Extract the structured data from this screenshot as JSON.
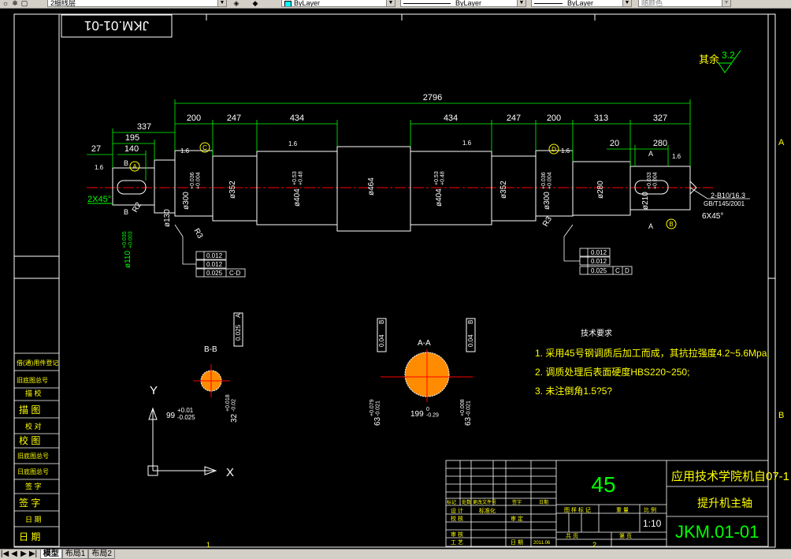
{
  "toolbar": {
    "layer_name": "2细线层",
    "color_value": "ByLayer",
    "linetype_value": "ByLayer",
    "lineweight_value": "ByLayer",
    "plotstyle_value": "随颜色"
  },
  "drawing": {
    "drawing_number_top": "JKM.01-01",
    "roughness_label": "其余",
    "roughness_value": "3.2",
    "overall_length": "2796",
    "dims_left": [
      "200",
      "247",
      "434"
    ],
    "dims_mid": [
      "434",
      "247"
    ],
    "dims_right": [
      "200",
      "313",
      "327"
    ],
    "dim_337": "337",
    "dim_195": "195",
    "dim_140": "140",
    "dim_27": "27",
    "dim_20": "20",
    "dim_280": "280",
    "chamfer_left": "2X45°",
    "chamfer_right": "6X45°",
    "dia_130": "ø130",
    "dia_110": "ø110",
    "tol_110": "+0.035\n+0.003",
    "dia_300": "ø300",
    "tol_300": "+0.036\n+0.004",
    "dia_352": "ø352",
    "dia_404": "ø404",
    "tol_404": "+0.53\n+0.48",
    "dia_464": "ø464",
    "dia_280": "ø280",
    "dia_210": "ø210",
    "tol_210": "+0.033\n+0.004",
    "center_hole_note": "2-B10/16.3",
    "center_hole_std": "GB/T145/2001",
    "r3": "R3",
    "r2": "R2",
    "ra16": "1.6",
    "datum_a": "A",
    "datum_b": "B",
    "datum_c": "C",
    "datum_d": "D",
    "gtol_runout1": "0.012",
    "gtol_runout2": "0.012",
    "gtol_perp": "0.025",
    "gtol_ref_left": "C-D",
    "gtol_ref_right_c": "C",
    "gtol_ref_right_d": "D",
    "sec_bb_label": "B-B",
    "sec_aa_label": "A-A",
    "sec_bb_width": "99",
    "sec_bb_width_tol": "+0.01\n-0.025",
    "sec_bb_depth": "32",
    "sec_bb_depth_tol": "+0.018\n-0.02",
    "sec_bb_gtol": "0.025",
    "sec_bb_gtol_ref": "A",
    "sec_aa_width": "199",
    "sec_aa_width_tol": "0\n-0.29",
    "sec_aa_key_left": "63",
    "sec_aa_key_tol": "+0.079\n-0.021",
    "sec_aa_key_right": "63",
    "sec_aa_key_tol2": "+0.008\n-0.021",
    "sec_aa_gtol": "0.04",
    "sec_aa_gtol_ref": "B",
    "tech_title": "技术要求",
    "tech_items": [
      "1. 采用45号钢调质后加工而成，其抗拉强度4.2~5.6Mpa;",
      "2. 调质处理后表面硬度HBS220~250;",
      "3. 未注倒角1.5?5?"
    ],
    "ucs_y": "Y",
    "ucs_x": "X",
    "grid_letters": [
      "A",
      "B"
    ],
    "grid_numbers": [
      "1",
      "2"
    ]
  },
  "left_strip": {
    "items": [
      "借(通)用件登记",
      "旧底图总号",
      "描  校",
      "描 图",
      "校 对",
      "校 图",
      "旧底图总号",
      "日底图总号",
      "签  字",
      "签 字",
      "日 期",
      "日 期"
    ]
  },
  "title_block": {
    "material": "45",
    "school": "应用技术学院机自07-1",
    "part_name": "提升机主轴",
    "drawing_no": "JKM.01-01",
    "scale_label": "比 例",
    "scale": "1:10",
    "weight_label": "重 量",
    "stage_label": "图 样 标 记",
    "sheet_total": "共    页",
    "sheet_no": "第    页",
    "row_labels": [
      "标记",
      "处数",
      "更改文件号",
      "签字",
      "日期"
    ],
    "roles": [
      "设 计",
      "校 核",
      "审 核",
      "工 艺"
    ],
    "std_label": "标准化",
    "approve_label": "审 定",
    "date_label": "日 期",
    "date": "2011.06",
    "role_names": [
      "签 名",
      "日期"
    ]
  },
  "tabs": {
    "model": "模型",
    "layout1": "布局1",
    "layout2": "布局2"
  }
}
